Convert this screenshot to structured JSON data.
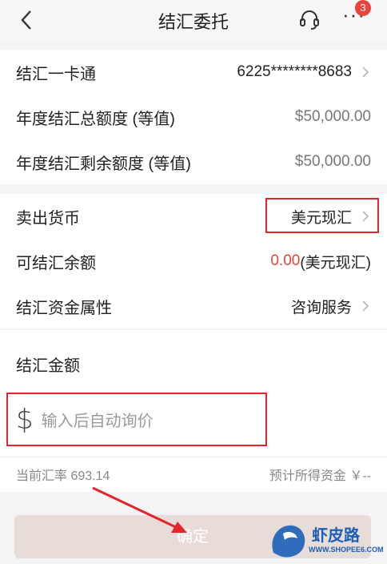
{
  "nav": {
    "title": "结汇委托",
    "badge": "3",
    "more": "···"
  },
  "account": {
    "card_label": "结汇一卡通",
    "card_value": "6225********8683",
    "total_label": "年度结汇总额度 (等值)",
    "total_value": "$50,000.00",
    "remaining_label": "年度结汇剩余额度 (等值)",
    "remaining_value": "$50,000.00"
  },
  "currency": {
    "sell_label": "卖出货币",
    "sell_value": "美元现汇",
    "balance_label": "可结汇余额",
    "balance_amount": "0.00",
    "balance_unit": "(美元现汇)",
    "property_label": "结汇资金属性",
    "property_value": "咨询服务"
  },
  "amount": {
    "label": "结汇金额",
    "currency_symbol": "$",
    "placeholder": "输入后自动询价"
  },
  "rate": {
    "current_label": "当前汇率 693.14",
    "estimate_label": "预计所得资金 ￥--"
  },
  "confirm_label": "确定",
  "watermark": {
    "brand": "虾皮路",
    "url": "WWW.SHOPEE6.COM"
  },
  "colors": {
    "accent_red": "#e8443c",
    "highlight_box": "#e3252b",
    "button_disabled": "#e8dcd8",
    "watermark_blue": "#1b5fb8"
  }
}
